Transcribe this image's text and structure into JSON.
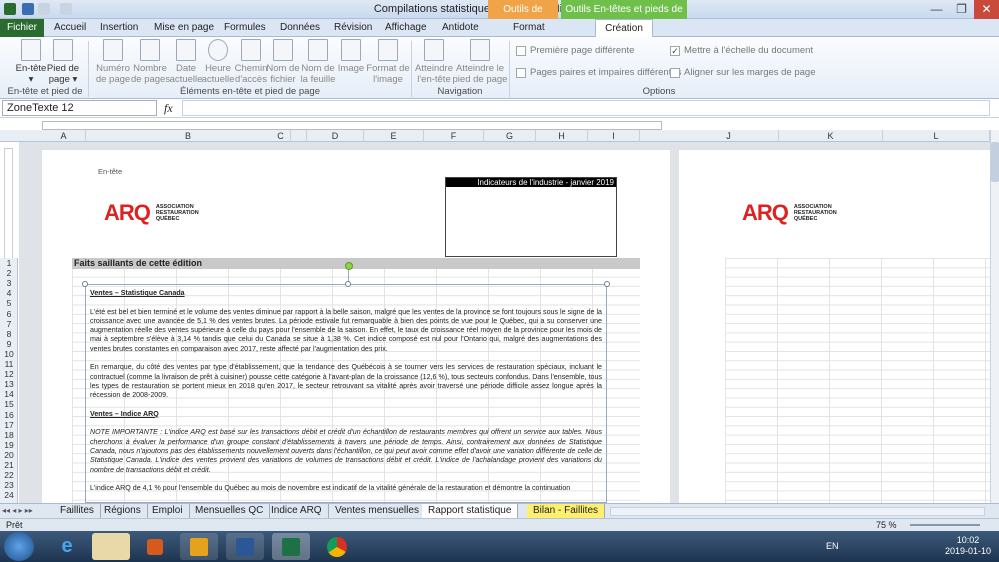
{
  "window": {
    "title": "Compilations statistiques en cours - Microsoft Excel"
  },
  "context_tabs": {
    "drawing": "Outils de dessin",
    "header_footer": "Outils En-têtes et pieds de page"
  },
  "tabs": [
    "Fichier",
    "Accueil",
    "Insertion",
    "Mise en page",
    "Formules",
    "Données",
    "Révision",
    "Affichage",
    "Antidote",
    "Format",
    "Création"
  ],
  "ribbon": {
    "buttons": [
      {
        "label": "En-tête\n▾"
      },
      {
        "label": "Pied de\npage ▾"
      },
      {
        "label": "Numéro\nde page"
      },
      {
        "label": "Nombre\nde pages"
      },
      {
        "label": "Date\nactuelle"
      },
      {
        "label": "Heure\nactuelle"
      },
      {
        "label": "Chemin\nd'accès"
      },
      {
        "label": "Nom de\nfichier"
      },
      {
        "label": "Nom de\nla feuille"
      },
      {
        "label": "Image"
      },
      {
        "label": "Format de\nl'image"
      },
      {
        "label": "Atteindre\nl'en-tête"
      },
      {
        "label": "Atteindre le\npied de page"
      }
    ],
    "groups": {
      "g1": "En-tête et pied de page",
      "g2": "Éléments en-tête et pied de page",
      "g3": "Navigation",
      "g4": "Options"
    },
    "options": [
      {
        "label": "Première page différente",
        "checked": false
      },
      {
        "label": "Pages paires et impaires différentes",
        "checked": false
      },
      {
        "label": "Mettre à l'échelle du document",
        "checked": true
      },
      {
        "label": "Aligner sur les marges de page",
        "checked": false
      }
    ]
  },
  "formula_bar": {
    "name_box": "ZoneTexte 12",
    "fx": "fx",
    "value": ""
  },
  "columns": [
    "A",
    "B",
    "C",
    "D",
    "E",
    "F",
    "G",
    "H",
    "I",
    "J",
    "K",
    "L"
  ],
  "rows": [
    "1",
    "2",
    "3",
    "4",
    "5",
    "6",
    "7",
    "8",
    "9",
    "10",
    "11",
    "12",
    "13",
    "14",
    "15",
    "16",
    "17",
    "18",
    "19",
    "20",
    "21",
    "22",
    "23",
    "24"
  ],
  "page": {
    "header_label": "En-tête",
    "logo": {
      "mark": "ARQ",
      "line1": "ASSOCIATION",
      "line2": "RESTAURATION",
      "line3": "QUÉBEC"
    },
    "header_box": "Indicateurs de l'industrie - janvier 2019",
    "section_title": "Faits saillants de cette édition",
    "paragraphs": [
      {
        "style": "h",
        "text": "Ventes – Statistique Canada"
      },
      {
        "style": "p",
        "text": "L'été est bel et bien terminé et le volume des ventes diminue par rapport à la belle saison, malgré que les ventes de la province se font toujours sous le signe de la croissance avec une avancée de 5,1 % des ventes brutes. La période estivale fut remarquable à bien des points de vue pour le Québec, qui a su conserver une augmentation réelle des ventes supérieure à celle du pays pour l'ensemble de la saison. En effet, le taux de croissance réel moyen de la province pour les mois de mai à septembre s'élève à 3,14 % tandis que celui du Canada se situe à 1,38 %. Cet indice composé est nul pour l'Ontario qui, malgré des augmentations des ventes brutes constantes en comparaison avec 2017, reste affecté par l'augmentation des prix."
      },
      {
        "style": "p",
        "text": "En remarque, du côté des ventes par type d'établissement, que la tendance des Québécois à se tourner vers les services de restauration spéciaux, incluant le contractuel (comme la livraison de prêt à cuisiner) pousse cette catégorie à l'avant-plan de la croissance (12,6 %), tous secteurs confondus. Dans l'ensemble, tous les types de restauration se portent mieux en 2018 qu'en 2017, le secteur retrouvant sa vitalité après avoir traversé une période difficile assez longue après la récession de 2008-2009."
      },
      {
        "style": "h",
        "text": "Ventes – Indice ARQ"
      },
      {
        "style": "it",
        "text": "NOTE IMPORTANTE : L'indice ARQ est basé sur les transactions débit et crédit d'un échantillon de restaurants membres qui offrent un service aux tables. Nous cherchons à évaluer la performance d'un groupe constant d'établissements à travers une période de temps. Ainsi, contrairement aux données de Statistique Canada, nous n'ajoutons pas des établissements nouvellement ouverts dans l'échantillon, ce qui peut avoir comme effet d'avoir une variation différente de celle de Statistique Canada. L'indice des ventes provient des variations de volumes de transactions débit et crédit. L'indice de l'achalandage provient des variations du nombre de transactions débit et crédit."
      },
      {
        "style": "p",
        "text": "L'indice ARQ de 4,1 % pour l'ensemble du Québec au mois de novembre est indicatif de la vitalité générale de la restauration et démontre la continuation"
      }
    ]
  },
  "sheet_tabs": [
    {
      "label": "Faillites",
      "style": ""
    },
    {
      "label": "Régions",
      "style": ""
    },
    {
      "label": "Emploi",
      "style": ""
    },
    {
      "label": "Mensuelles QC",
      "style": ""
    },
    {
      "label": "Indice ARQ",
      "style": ""
    },
    {
      "label": "Ventes mensuelles",
      "style": ""
    },
    {
      "label": "Rapport statistique",
      "style": "active"
    },
    {
      "label": "Bilan - Faillites",
      "style": "yellow"
    }
  ],
  "status": {
    "ready": "Prêt",
    "zoom": "75 %"
  },
  "taskbar": {
    "lang": "EN",
    "time": "10:02",
    "date": "2019-01-10"
  },
  "colors": {
    "file_tab": "#2a6b2f",
    "drawing_ctx": "#f0a347",
    "hf_ctx": "#6fbf4b",
    "logo": "#dd2222"
  }
}
